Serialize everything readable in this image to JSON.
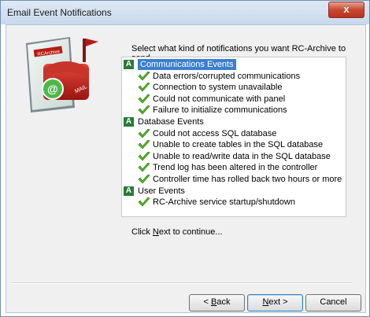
{
  "window": {
    "title": "Email Event Notifications",
    "close_glyph": "x"
  },
  "art": {
    "brand": "RCArchive",
    "mailbox_text": "MAIL"
  },
  "prompt": "Select what kind of notifications you want RC-Archive to send.",
  "categories": [
    {
      "label": "Communications Events",
      "badge": "A",
      "selected": true,
      "items": [
        "Data errors/corrupted communications",
        "Connection to system unavailable",
        "Could not communicate with panel",
        "Failure to initialize communications"
      ]
    },
    {
      "label": "Database Events",
      "badge": "A",
      "selected": false,
      "items": [
        "Could not access SQL database",
        "Unable to create tables in the SQL database",
        "Unable to read/write data in the SQL database",
        "Trend log has been altered in the controller",
        "Controller time has rolled back two hours or more"
      ]
    },
    {
      "label": "User Events",
      "badge": "A",
      "selected": false,
      "items": [
        "RC-Archive service startup/shutdown"
      ]
    }
  ],
  "hint": {
    "before": "Click ",
    "key": "N",
    "after": "ext to continue..."
  },
  "buttons": {
    "back": {
      "before": "< ",
      "key": "B",
      "after": "ack"
    },
    "next": {
      "key": "N",
      "after": "ext >"
    },
    "cancel": "Cancel"
  },
  "colors": {
    "selection": "#3b7fd0",
    "badge": "#2c7a3a",
    "check": "#58b82a"
  }
}
